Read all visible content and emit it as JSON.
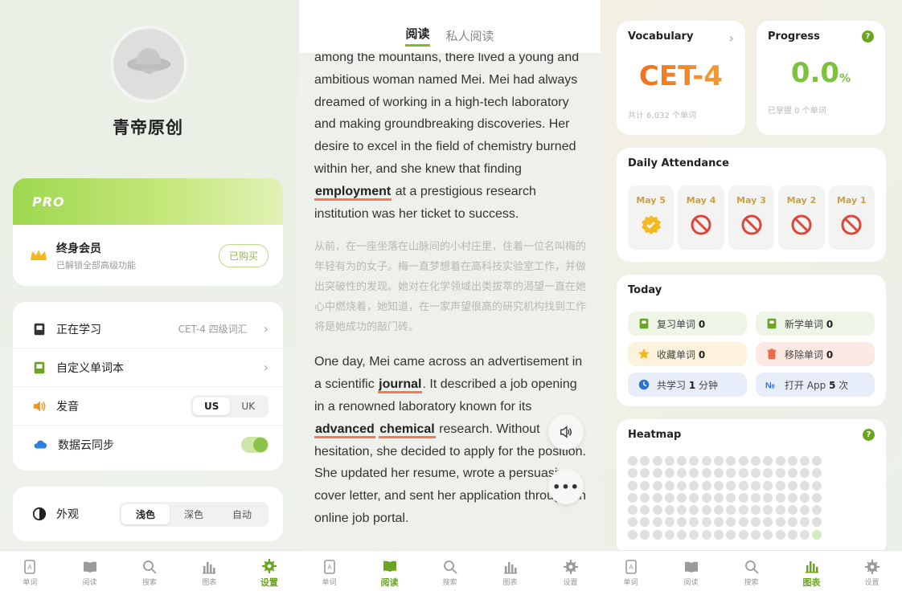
{
  "colors": {
    "accent": "#6aa520",
    "highlight": "#f07a5a",
    "orange": "#f07a2a"
  },
  "settings": {
    "user_name": "青帝原创",
    "pro": {
      "badge": "PRO",
      "title": "终身会员",
      "subtitle": "已解锁全部高级功能",
      "status": "已购买"
    },
    "rows": [
      {
        "label": "正在学习",
        "value": "CET-4 四级词汇",
        "icon": "book-icon"
      },
      {
        "label": "自定义单词本",
        "value": "",
        "icon": "book-green-icon"
      },
      {
        "label": "发音",
        "options": [
          "US",
          "UK"
        ],
        "selected": "US",
        "icon": "speaker-icon"
      },
      {
        "label": "数据云同步",
        "toggle": true,
        "icon": "cloud-icon"
      }
    ],
    "appearance": {
      "label": "外观",
      "options": [
        "浅色",
        "深色",
        "自动"
      ],
      "selected": "浅色"
    }
  },
  "tabbar": {
    "items": [
      {
        "label": "单词",
        "icon": "word-icon"
      },
      {
        "label": "阅读",
        "icon": "book-open-icon"
      },
      {
        "label": "搜索",
        "icon": "search-icon"
      },
      {
        "label": "图表",
        "icon": "chart-icon"
      },
      {
        "label": "设置",
        "icon": "gear-icon"
      }
    ],
    "active_panel1": 4,
    "active_panel2": 1,
    "active_panel3": 3
  },
  "reading": {
    "tabs": [
      "阅读",
      "私人阅读"
    ],
    "active_tab": 0,
    "p1_pre": "among the mountains, there lived a young and ambitious woman named Mei. Mei had always dreamed of working in a high-tech laboratory and making groundbreaking discoveries. Her desire to excel in the field of chemistry burned within her, and she knew that finding ",
    "p1_hl1": "employment",
    "p1_post": " at a prestigious research institution was her ticket to success.",
    "zh": "从前，在一座坐落在山脉间的小村庄里，住着一位名叫梅的年轻有为的女子。梅一直梦想着在高科技实验室工作，并做出突破性的发现。她对在化学领域出类拔萃的渴望一直在她心中燃烧着，她知道，在一家声望很高的研究机构找到工作将是她成功的敲门砖。",
    "p2_a": "One day, Mei came across an advertisement in a scientific ",
    "p2_hl1": "journal",
    "p2_b": ". It described a job opening in a renowned laboratory known for its ",
    "p2_hl2": "advanced",
    "p2_hl3": "chemical",
    "p2_c": " research. Without hesitation, she decided to apply for the position. She updated her resume, wrote a persuasive cover letter, and sent her application through an online job portal."
  },
  "stats": {
    "vocabulary": {
      "title": "Vocabulary",
      "value": "CET-4",
      "sub": "共计 6,032 个单词"
    },
    "progress": {
      "title": "Progress",
      "value": "0.0",
      "unit": "%",
      "sub": "已掌握 0 个单词"
    },
    "attendance": {
      "title": "Daily Attendance",
      "days": [
        {
          "date": "May 5",
          "status": "checked"
        },
        {
          "date": "May 4",
          "status": "missed"
        },
        {
          "date": "May 3",
          "status": "missed"
        },
        {
          "date": "May 2",
          "status": "missed"
        },
        {
          "date": "May 1",
          "status": "missed"
        }
      ]
    },
    "today": {
      "title": "Today",
      "items": [
        {
          "label": "复习单词",
          "value": "0",
          "icon": "review-icon",
          "color": "#eef5e6"
        },
        {
          "label": "新学单词",
          "value": "0",
          "icon": "new-word-icon",
          "color": "#eef5e6"
        },
        {
          "label": "收藏单词",
          "value": "0",
          "icon": "star-icon",
          "color": "#fdf3dc"
        },
        {
          "label": "移除单词",
          "value": "0",
          "icon": "trash-icon",
          "color": "#fde9e3"
        },
        {
          "label": "共学习",
          "value": "1",
          "suffix": "分钟",
          "icon": "clock-icon",
          "color": "#e8eef9"
        },
        {
          "label": "打开 App",
          "value": "5",
          "suffix": "次",
          "icon": "number-icon",
          "color": "#e8eef9"
        }
      ]
    },
    "heatmap": {
      "title": "Heatmap",
      "active_cell": 111,
      "cells": 112
    }
  }
}
